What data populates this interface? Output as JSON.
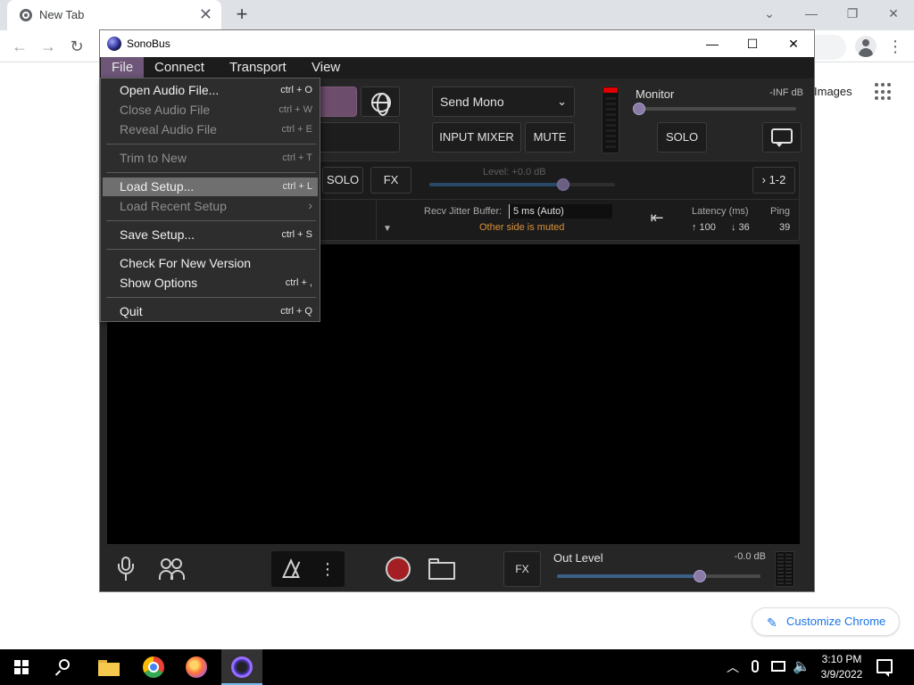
{
  "browser": {
    "tab_title": "New Tab",
    "tab_close": "✕",
    "new_tab": "+",
    "images_link": "Images",
    "customize_label": "Customize Chrome"
  },
  "sonobus": {
    "window_title": "SonoBus",
    "menubar": [
      "File",
      "Connect",
      "Transport",
      "View"
    ],
    "send_mode": "Send Mono",
    "input_mixer_label": "INPUT MIXER",
    "mute_label": "MUTE",
    "monitor_label": "Monitor",
    "monitor_db": "-INF dB",
    "monitor_level": 0.0,
    "monitor_solo_label": "SOLO",
    "peer": {
      "solo_label": "SOLO",
      "fx_label": "FX",
      "level_label": "Level: +0.0 dB",
      "level": 0.72,
      "channel_label": "› 1-2",
      "jitter_label": "Recv Jitter Buffer:",
      "jitter_value": "5 ms (Auto)",
      "status": "Other side is muted",
      "latency_label": "Latency (ms)",
      "ping_label": "Ping",
      "latency_up": "↑ 100",
      "latency_down": "↓ 36",
      "ping_value": "39"
    },
    "bottom": {
      "fx_label": "FX",
      "out_level_label": "Out Level",
      "out_level_db": "-0.0 dB",
      "out_level": 0.7
    }
  },
  "file_menu": {
    "items": [
      {
        "label": "Open Audio File...",
        "shortcut": "ctrl + O",
        "disabled": false
      },
      {
        "label": "Close Audio File",
        "shortcut": "ctrl + W",
        "disabled": true
      },
      {
        "label": "Reveal Audio File",
        "shortcut": "ctrl + E",
        "disabled": true
      },
      {
        "label": "Trim to New",
        "shortcut": "ctrl + T",
        "disabled": true
      },
      {
        "label": "Load Setup...",
        "shortcut": "ctrl + L",
        "disabled": false
      },
      {
        "label": "Load Recent Setup",
        "shortcut": "",
        "disabled": true
      },
      {
        "label": "Save Setup...",
        "shortcut": "ctrl + S",
        "disabled": false
      },
      {
        "label": "Check For New Version",
        "shortcut": "",
        "disabled": false
      },
      {
        "label": "Show Options",
        "shortcut": "ctrl + ,",
        "disabled": false
      },
      {
        "label": "Quit",
        "shortcut": "ctrl + Q",
        "disabled": false
      }
    ],
    "highlighted": "Load Setup..."
  },
  "taskbar": {
    "time": "3:10 PM",
    "date": "3/9/2022"
  },
  "colors": {
    "menu_active": "#6d5678",
    "connect_button": "#6c4d6c",
    "slider_fill": "#3c5f86",
    "slider_knob": "#8a7aa8",
    "status_orange": "#d9913a",
    "record_red": "#a31f24",
    "accent_blue": "#1a73e8"
  },
  "icons": [
    "chrome-favicon",
    "profile-icon",
    "menu-dots-icon",
    "apps-grid-icon",
    "pencil-icon",
    "sonobus-logo",
    "globe-icon",
    "chat-icon",
    "reset-icon",
    "microphone-icon",
    "people-icon",
    "metronome-icon",
    "more-options-icon",
    "record-icon",
    "folder-icon",
    "windows-start-icon",
    "search-icon",
    "file-explorer-icon",
    "chrome-icon",
    "firefox-icon",
    "volume-icon",
    "notification-icon"
  ]
}
